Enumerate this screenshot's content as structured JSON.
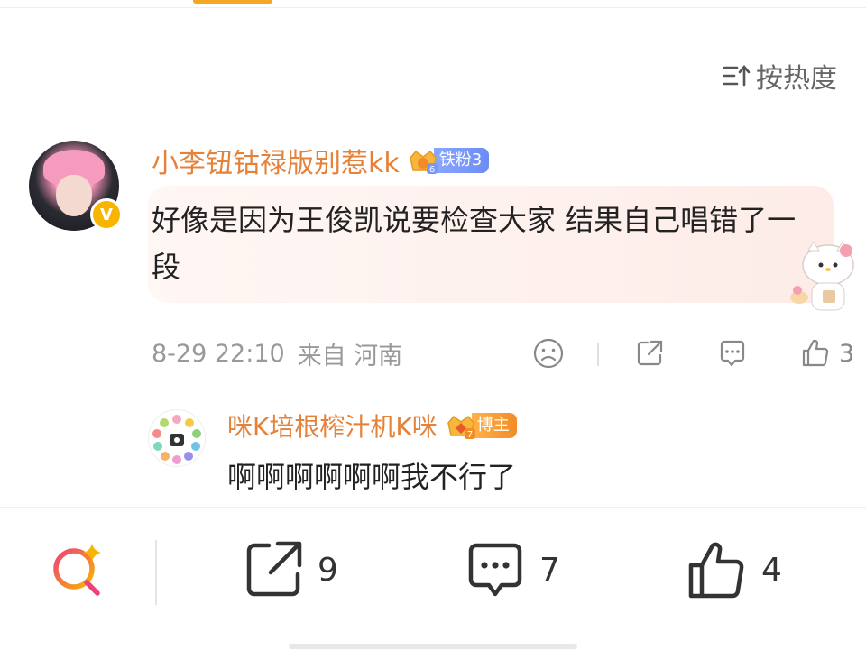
{
  "sort": {
    "label": "按热度"
  },
  "comment": {
    "username": "小李钮钴禄版别惹kk",
    "fan_badge": {
      "level": "6",
      "label": "铁粉3"
    },
    "text": "好像是因为王俊凯说要检查大家 结果自己唱错了一段",
    "meta": {
      "time": "8-29 22:10",
      "location": "来自 河南"
    },
    "like_count": "3"
  },
  "reply": {
    "username": "咪K培根榨汁机K咪",
    "badge": {
      "level": "7",
      "label": "博主"
    },
    "text": "啊啊啊啊啊啊我不行了"
  },
  "bottom_bar": {
    "share_count": "9",
    "comment_count": "7",
    "like_count": "4"
  },
  "colors": {
    "username": "#e5823a",
    "fan_badge": "#7a97f7",
    "blogger_badge": "#f28c28",
    "search_icon_gradient": [
      "#f0407a",
      "#f7b500"
    ]
  }
}
